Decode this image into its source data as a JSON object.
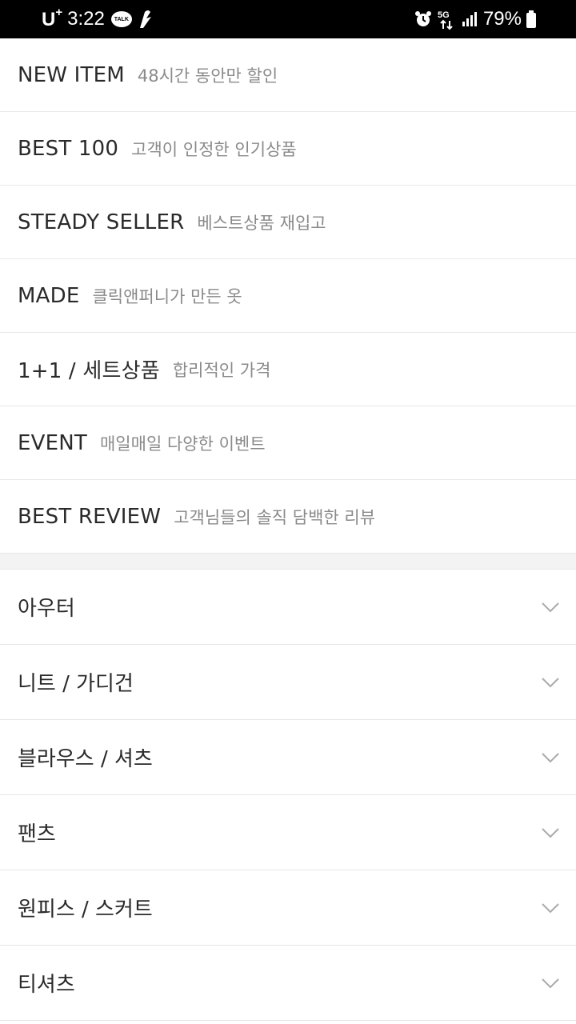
{
  "status_bar": {
    "carrier": "U",
    "carrier_sup": "+",
    "time": "3:22",
    "talk_badge": "TALK",
    "network": "5G",
    "battery": "79%"
  },
  "featured": [
    {
      "title": "NEW ITEM",
      "subtitle": "48시간 동안만 할인"
    },
    {
      "title": "BEST 100",
      "subtitle": "고객이 인정한 인기상품"
    },
    {
      "title": "STEADY SELLER",
      "subtitle": "베스트상품 재입고"
    },
    {
      "title": "MADE",
      "subtitle": "클릭앤퍼니가 만든 옷"
    },
    {
      "title": "1+1 / 세트상품",
      "subtitle": "합리적인 가격"
    },
    {
      "title": "EVENT",
      "subtitle": "매일매일 다양한 이벤트"
    },
    {
      "title": "BEST REVIEW",
      "subtitle": "고객님들의 솔직 담백한 리뷰"
    }
  ],
  "categories": [
    {
      "label": "아우터"
    },
    {
      "label": "니트 / 가디건"
    },
    {
      "label": "블라우스 / 셔츠"
    },
    {
      "label": "팬츠"
    },
    {
      "label": "원피스 / 스커트"
    },
    {
      "label": "티셔츠"
    }
  ]
}
